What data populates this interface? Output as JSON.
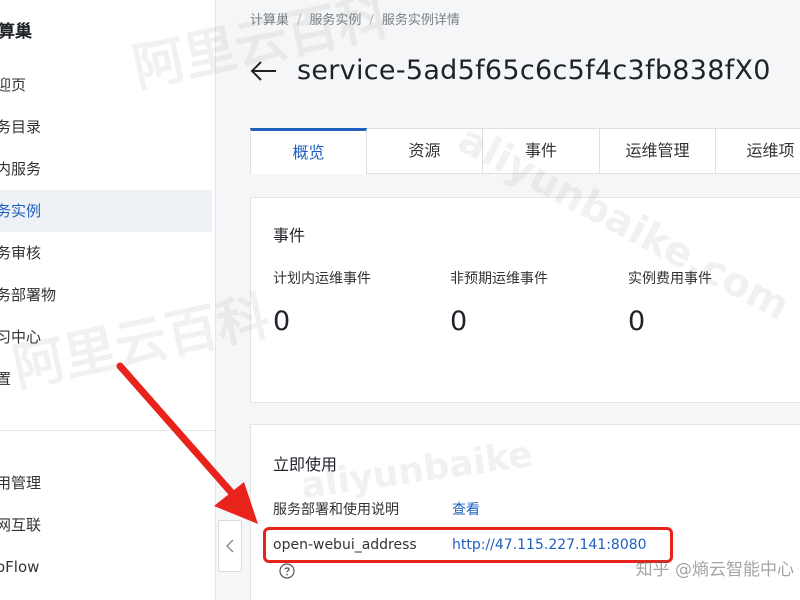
{
  "sidebar": {
    "title": "算巢",
    "items": [
      {
        "label": "迎页"
      },
      {
        "label": "务目录"
      },
      {
        "label": "内服务"
      },
      {
        "label": "务实例"
      },
      {
        "label": "务审核"
      },
      {
        "label": "务部署物"
      },
      {
        "label": "习中心"
      },
      {
        "label": "置"
      },
      {
        "label": "用管理"
      },
      {
        "label": "网互联"
      },
      {
        "label": "oFlow"
      }
    ]
  },
  "breadcrumb": [
    "计算巢",
    "服务实例",
    "服务实例详情"
  ],
  "page_title": "service-5ad5f65c6c5f4c3fb838fX0",
  "tabs": [
    "概览",
    "资源",
    "事件",
    "运维管理",
    "运维项"
  ],
  "events_card": {
    "title": "事件",
    "stats": [
      {
        "label": "计划内运维事件",
        "value": "0"
      },
      {
        "label": "非预期运维事件",
        "value": "0"
      },
      {
        "label": "实例费用事件",
        "value": "0"
      }
    ]
  },
  "use_card": {
    "title": "立即使用",
    "deploy_doc_label": "服务部署和使用说明",
    "deploy_doc_link": "查看",
    "address_label": "open-webui_address",
    "address_value": "http://47.115.227.141:8080"
  },
  "watermarks": {
    "top": "阿里云百科",
    "mid": "阿里云百科",
    "latin": "aliyunbaike.com",
    "latin2": "aliyunbaike",
    "corner": "知乎 @熵云智能中心"
  },
  "colors": {
    "accent": "#1f5fbf",
    "highlight": "#e8231b"
  }
}
